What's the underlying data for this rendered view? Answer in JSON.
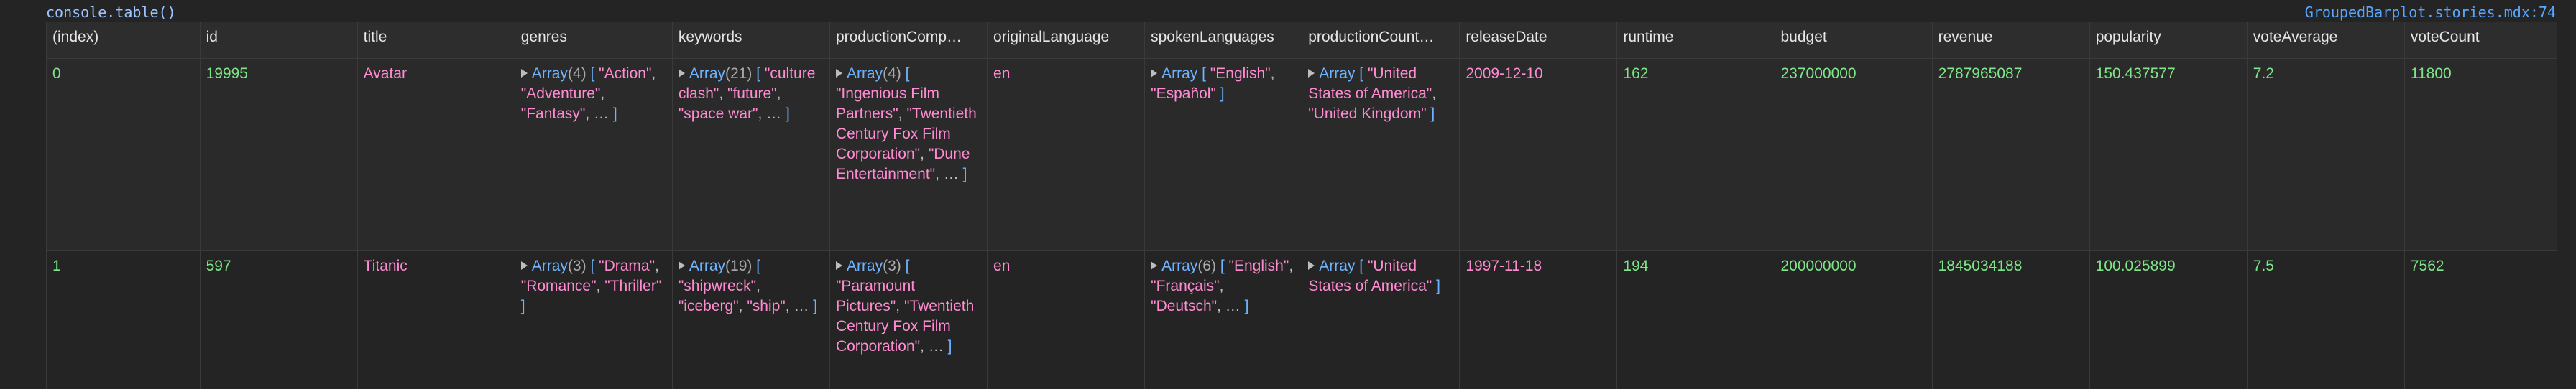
{
  "console": {
    "label": "console.table()",
    "source": "GroupedBarplot.stories.mdx:74"
  },
  "columns": [
    "(index)",
    "id",
    "title",
    "genres",
    "keywords",
    "productionComp…",
    "originalLanguage",
    "spokenLanguages",
    "productionCount…",
    "releaseDate",
    "runtime",
    "budget",
    "revenue",
    "popularity",
    "voteAverage",
    "voteCount"
  ],
  "rows": [
    {
      "index": "0",
      "id": "19995",
      "title": "Avatar",
      "genres": {
        "kw": "Array",
        "count": "(4)",
        "items": [
          "\"Action\"",
          "\"Adventure\"",
          "\"Fantasy\""
        ],
        "more": true
      },
      "keywords": {
        "kw": "Array",
        "count": "(21)",
        "items": [
          "\"culture clash\"",
          "\"future\"",
          "\"space war\""
        ],
        "more": true
      },
      "productionCompanies": {
        "kw": "Array",
        "count": "(4)",
        "items": [
          "\"Ingenious Film Partners\"",
          "\"Twentieth Century Fox Film Corporation\"",
          "\"Dune Entertainment\""
        ],
        "more": true
      },
      "originalLanguage": "en",
      "spokenLanguages": {
        "kw": "Array",
        "count": "",
        "items": [
          "\"English\"",
          "\"Español\""
        ],
        "more": false
      },
      "productionCountries": {
        "kw": "Array",
        "count": "",
        "items": [
          "\"United States of America\"",
          "\"United Kingdom\""
        ],
        "more": false
      },
      "releaseDate": "2009-12-10",
      "runtime": "162",
      "budget": "237000000",
      "revenue": "2787965087",
      "popularity": "150.437577",
      "voteAverage": "7.2",
      "voteCount": "11800"
    },
    {
      "index": "1",
      "id": "597",
      "title": "Titanic",
      "genres": {
        "kw": "Array",
        "count": "(3)",
        "items": [
          "\"Drama\"",
          "\"Romance\"",
          "\"Thriller\""
        ],
        "more": false
      },
      "keywords": {
        "kw": "Array",
        "count": "(19)",
        "items": [
          "\"shipwreck\"",
          "\"iceberg\"",
          "\"ship\""
        ],
        "more": true
      },
      "productionCompanies": {
        "kw": "Array",
        "count": "(3)",
        "items": [
          "\"Paramount Pictures\"",
          "\"Twentieth Century Fox Film Corporation\""
        ],
        "more": true
      },
      "originalLanguage": "en",
      "spokenLanguages": {
        "kw": "Array",
        "count": "(6)",
        "items": [
          "\"English\"",
          "\"Français\"",
          "\"Deutsch\""
        ],
        "more": true
      },
      "productionCountries": {
        "kw": "Array",
        "count": "",
        "items": [
          "\"United States of America\""
        ],
        "more": false
      },
      "releaseDate": "1997-11-18",
      "runtime": "194",
      "budget": "200000000",
      "revenue": "1845034188",
      "popularity": "100.025899",
      "voteAverage": "7.5",
      "voteCount": "7562"
    }
  ],
  "strings": {
    "ellipsis": "…",
    "open_bracket": "[",
    "close_bracket": "]",
    "separator": ","
  }
}
